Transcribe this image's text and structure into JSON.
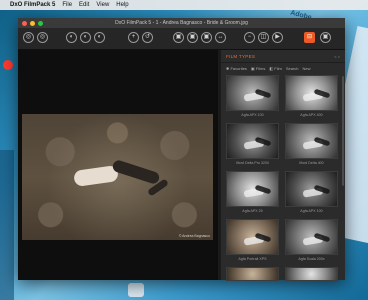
{
  "menubar": {
    "apple": "",
    "items": [
      "DxO FilmPack 5",
      "File",
      "Edit",
      "View",
      "Help"
    ]
  },
  "desktop": {
    "tag": "Adobe"
  },
  "window": {
    "title": "DxO FilmPack 5 - 1 - Andrea Bagnasco - Bride & Groom.jpg"
  },
  "toolbar": {
    "buttons": [
      "◎",
      "◎",
      "◐",
      "◐",
      "◐",
      "+",
      "↺",
      "▣",
      "▣",
      "▣",
      "↔",
      "−",
      "◫",
      "▶",
      "⊟",
      "▣"
    ]
  },
  "photo": {
    "credit": "© Andrea Bagnasco"
  },
  "panel": {
    "title": "FILM TYPES",
    "controls": "< >",
    "filters": [
      "✱ Favorites",
      "▣ Films",
      "◧ Film",
      "Search",
      "New"
    ],
    "thumbnails": [
      {
        "caption": "Agfa APX 100"
      },
      {
        "caption": "Agfa APX 400"
      },
      {
        "caption": "Ilford Delta Pro 3200"
      },
      {
        "caption": "Ilford Delta 400"
      },
      {
        "caption": "Agfa APX 25"
      },
      {
        "caption": "Agfa APX 100"
      },
      {
        "caption": "Agfa Portrait XPS"
      },
      {
        "caption": "Agfa Scala 200x"
      }
    ]
  },
  "colors": {
    "accent": "#ee5a24",
    "panel_bg": "#2b2b2b",
    "viewer_bg": "#0e0e0e"
  }
}
